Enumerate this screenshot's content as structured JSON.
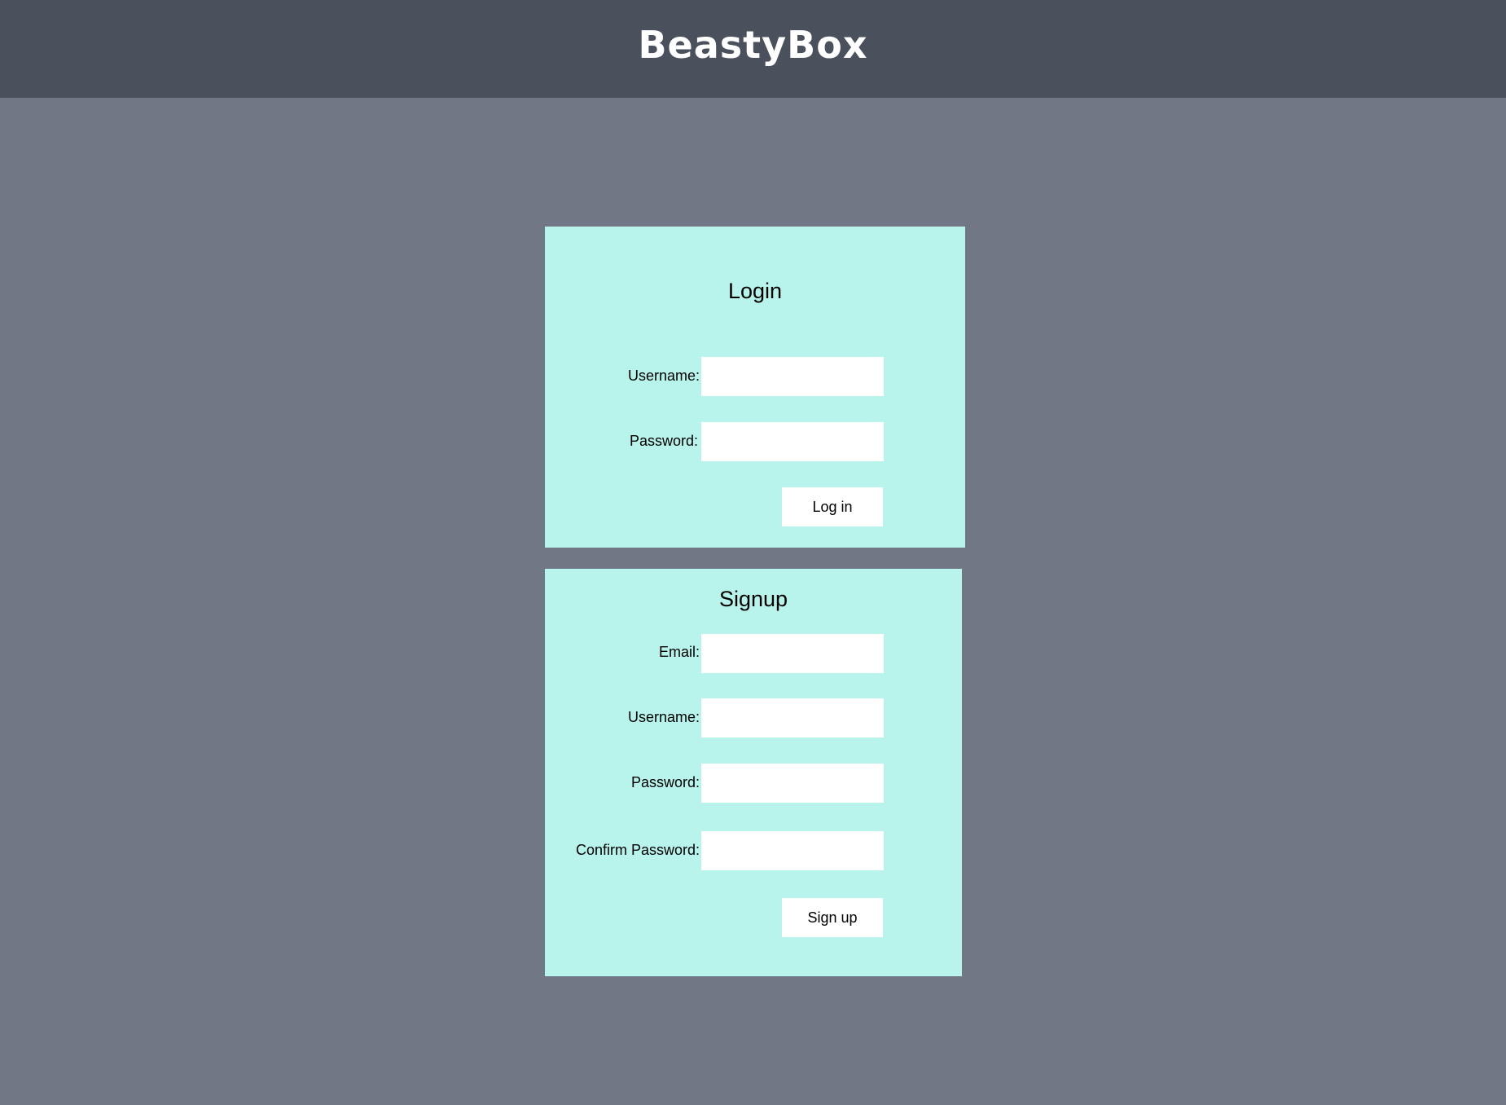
{
  "app": {
    "brand": "BeastyBox"
  },
  "colors": {
    "background": "#717784",
    "header": "#4a515c",
    "card": "#b8f4ec",
    "input": "#ffffff"
  },
  "login": {
    "title": "Login",
    "username_label": "Username:",
    "username_value": "",
    "password_label": "Password:",
    "password_value": "",
    "submit_label": "Log in"
  },
  "signup": {
    "title": "Signup",
    "email_label": "Email:",
    "email_value": "",
    "username_label": "Username:",
    "username_value": "",
    "password_label": "Password:",
    "password_value": "",
    "confirm_label": "Confirm Password:",
    "confirm_value": "",
    "submit_label": "Sign up"
  }
}
